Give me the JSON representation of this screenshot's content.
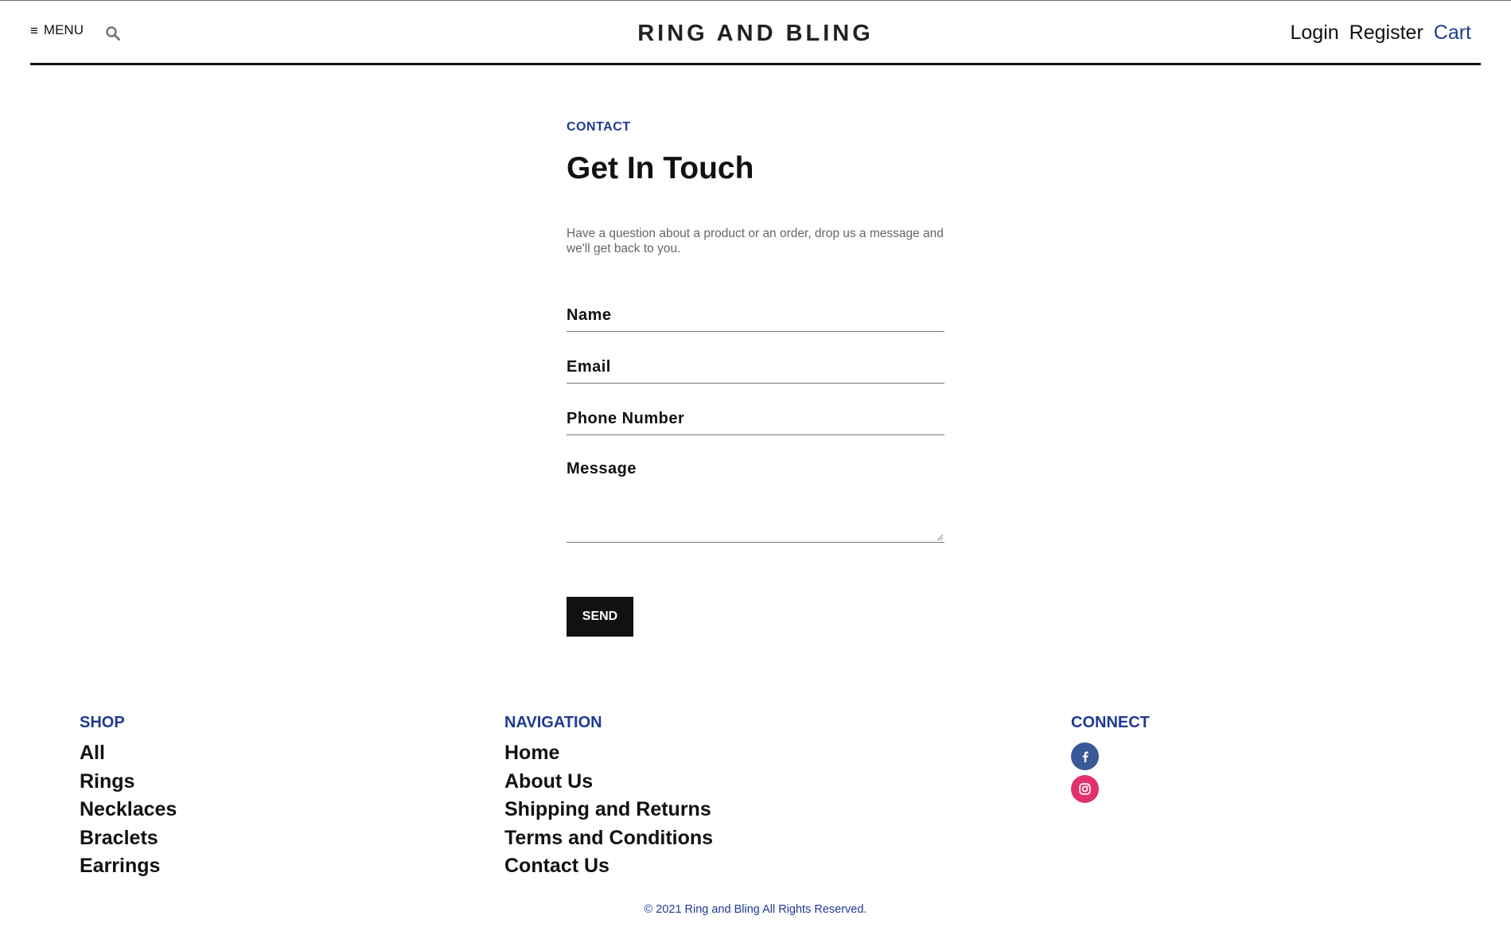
{
  "header": {
    "menu_label": "MENU",
    "brand": "RING AND BLING",
    "links": {
      "login": "Login",
      "register": "Register",
      "cart": "Cart"
    }
  },
  "contact": {
    "eyebrow": "CONTACT",
    "title": "Get In Touch",
    "intro": "Have a question about a product or an order, drop us a message and we'll get back to you.",
    "fields": {
      "name_placeholder": "Name",
      "email_placeholder": "Email",
      "phone_placeholder": "Phone Number",
      "message_placeholder": "Message"
    },
    "send_label": "SEND"
  },
  "footer": {
    "shop": {
      "heading": "SHOP",
      "links": [
        "All",
        "Rings",
        "Necklaces",
        "Braclets",
        "Earrings"
      ]
    },
    "navigation": {
      "heading": "NAVIGATION",
      "links": [
        "Home",
        "About Us",
        "Shipping and Returns",
        "Terms and Conditions",
        "Contact Us"
      ]
    },
    "connect": {
      "heading": "CONNECT",
      "icons": [
        "facebook-icon",
        "instagram-icon"
      ],
      "colors": {
        "facebook": "#3b5998",
        "instagram": "#e1306c"
      }
    },
    "copyright": "© 2021 Ring and Bling All Rights Reserved."
  },
  "colors": {
    "accent": "#1f3a93",
    "button": "#111111"
  }
}
